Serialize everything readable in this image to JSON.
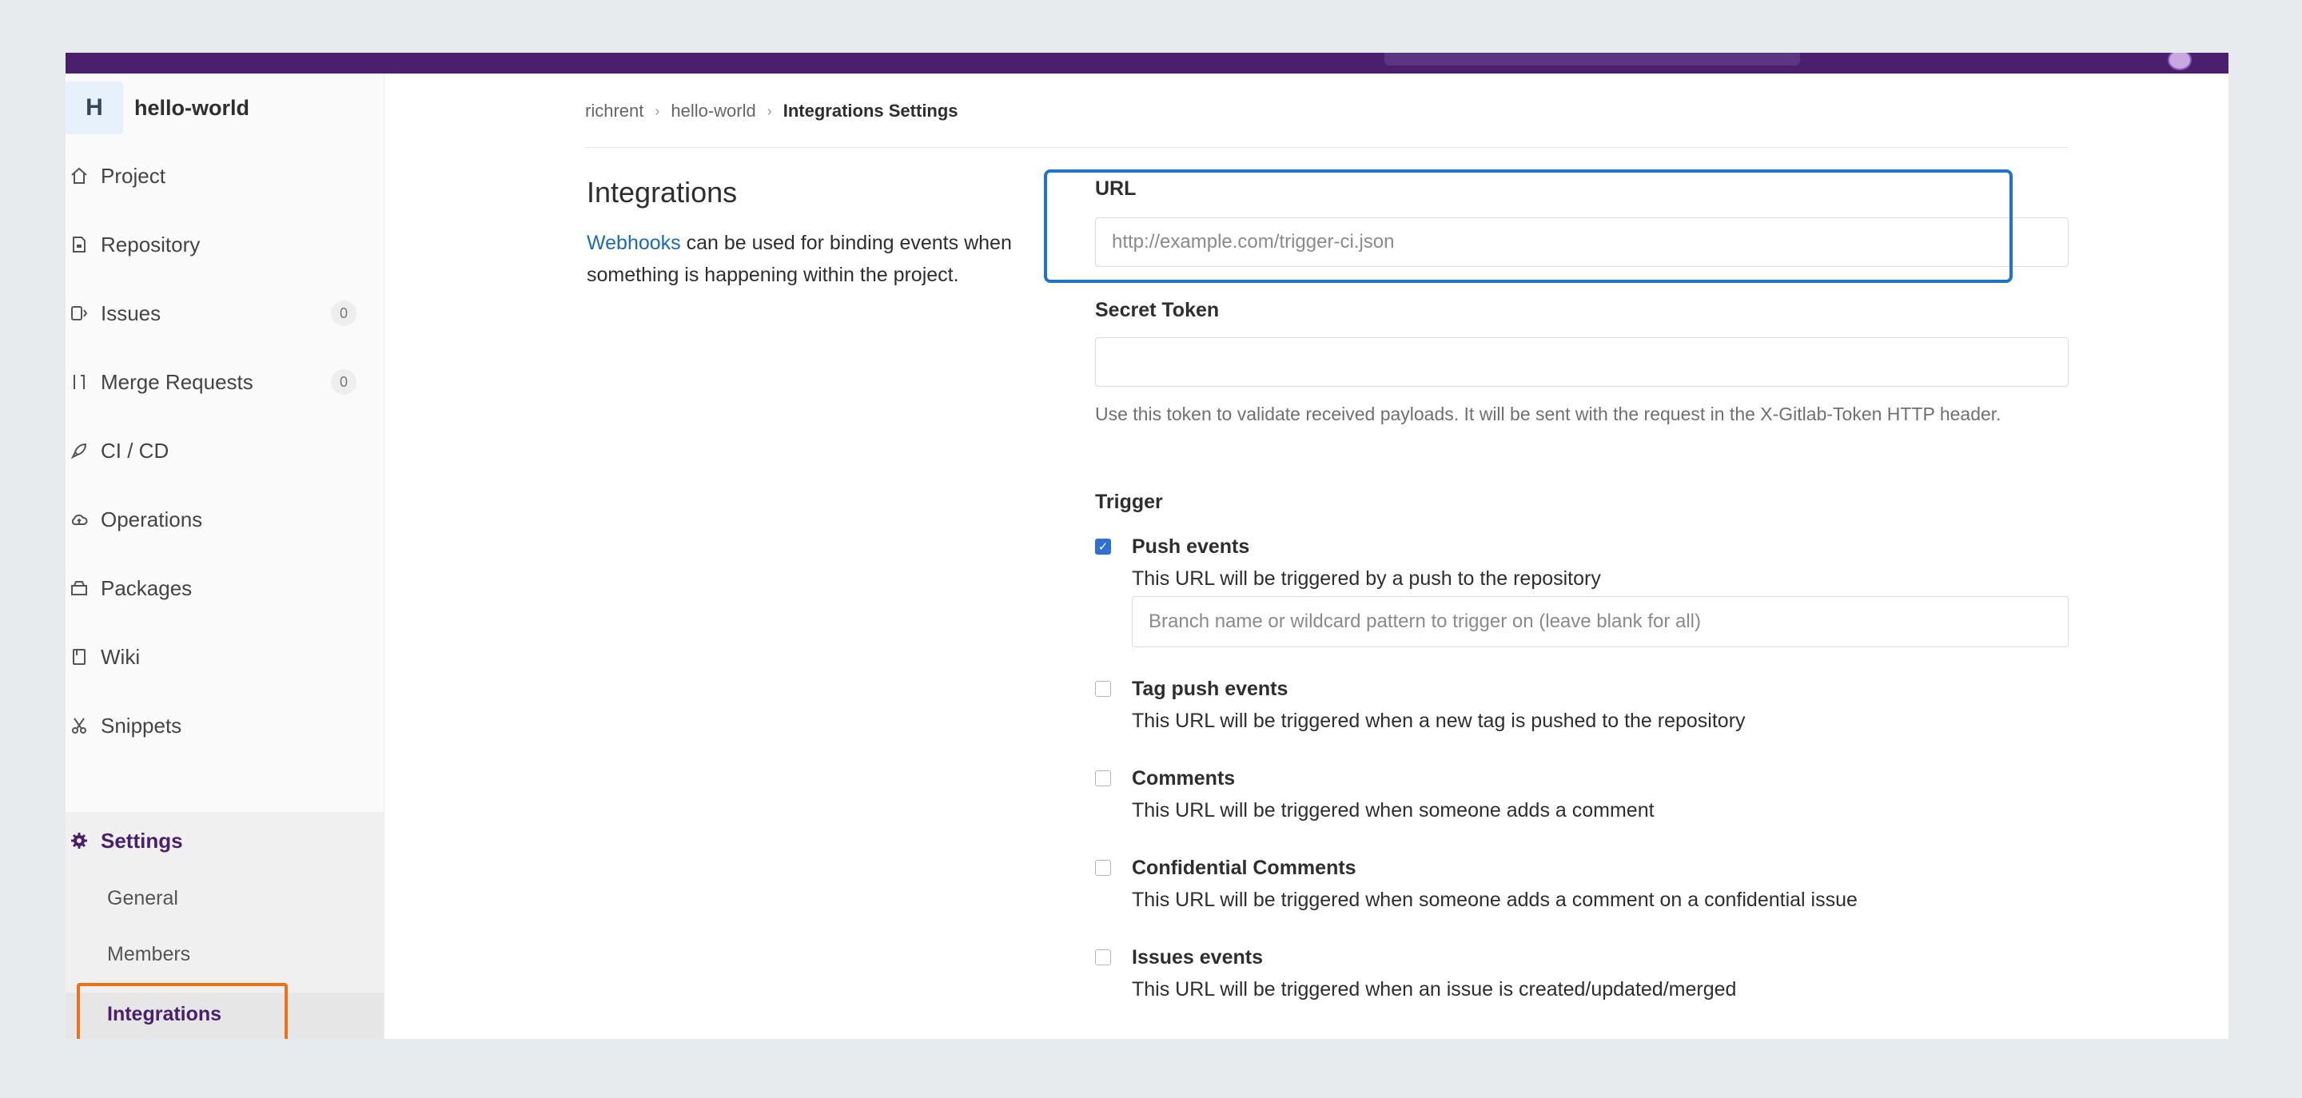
{
  "sidebar": {
    "project_avatar": "H",
    "project_name": "hello-world",
    "items": [
      {
        "label": "Project",
        "icon": "home-icon"
      },
      {
        "label": "Repository",
        "icon": "file-icon"
      },
      {
        "label": "Issues",
        "icon": "issues-icon",
        "badge": "0"
      },
      {
        "label": "Merge Requests",
        "icon": "merge-request-icon",
        "badge": "0"
      },
      {
        "label": "CI / CD",
        "icon": "rocket-icon"
      },
      {
        "label": "Operations",
        "icon": "cloud-icon"
      },
      {
        "label": "Packages",
        "icon": "package-icon"
      },
      {
        "label": "Wiki",
        "icon": "book-icon"
      },
      {
        "label": "Snippets",
        "icon": "scissors-icon"
      },
      {
        "label": "Settings",
        "icon": "gear-icon"
      }
    ],
    "settings_sub": [
      "General",
      "Members",
      "Integrations"
    ]
  },
  "breadcrumb": {
    "user": "richrent",
    "project": "hello-world",
    "current": "Integrations Settings"
  },
  "intro": {
    "title": "Integrations",
    "link": "Webhooks",
    "text": " can be used for binding events when something is happening within the project."
  },
  "form": {
    "url_label": "URL",
    "url_placeholder": "http://example.com/trigger-ci.json",
    "secret_label": "Secret Token",
    "secret_help": "Use this token to validate received payloads. It will be sent with the request in the X-Gitlab-Token HTTP header.",
    "trigger_label": "Trigger",
    "branch_placeholder": "Branch name or wildcard pattern to trigger on (leave blank for all)",
    "triggers": [
      {
        "title": "Push events",
        "desc": "This URL will be triggered by a push to the repository",
        "checked": true
      },
      {
        "title": "Tag push events",
        "desc": "This URL will be triggered when a new tag is pushed to the repository",
        "checked": false
      },
      {
        "title": "Comments",
        "desc": "This URL will be triggered when someone adds a comment",
        "checked": false
      },
      {
        "title": "Confidential Comments",
        "desc": "This URL will be triggered when someone adds a comment on a confidential issue",
        "checked": false
      },
      {
        "title": "Issues events",
        "desc": "This URL will be triggered when an issue is created/updated/merged",
        "checked": false
      }
    ]
  },
  "colors": {
    "topbar": "#4a1f6e",
    "highlight_blue": "#1d74c9",
    "highlight_orange": "#e8731a",
    "link": "#1b69b6"
  }
}
